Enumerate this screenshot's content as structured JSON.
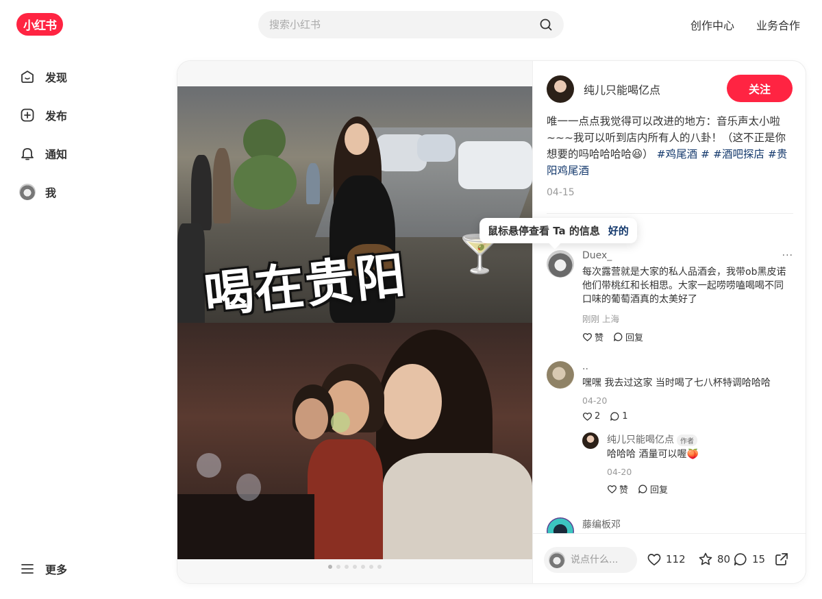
{
  "header": {
    "logo_text": "小红书",
    "search_placeholder": "搜索小红书",
    "nav": [
      "创作中心",
      "业务合作"
    ]
  },
  "sidebar": {
    "items": [
      {
        "label": "发现",
        "icon": "discover-icon"
      },
      {
        "label": "发布",
        "icon": "publish-icon"
      },
      {
        "label": "通知",
        "icon": "bell-icon"
      },
      {
        "label": "我",
        "icon": "avatar"
      }
    ],
    "more_label": "更多"
  },
  "note": {
    "image_caption": "喝在贵阳",
    "carousel_count": 7,
    "carousel_active": 1,
    "author": "纯儿只能喝亿点",
    "follow_label": "关注",
    "desc_text": "唯一一点点我觉得可以改进的地方：音乐声太小啦~~~我可以听到店内所有人的八卦！（这不正是你想要的吗哈哈哈哈😆）",
    "tags": [
      "#鸡尾酒",
      "#",
      "#酒吧探店",
      "#贵阳鸡尾酒"
    ],
    "date": "04-15"
  },
  "tooltip": {
    "text": "鼠标悬停查看 Ta 的信息",
    "ok_label": "好的"
  },
  "comments": [
    {
      "name": "Duex_",
      "text": "每次露营就是大家的私人品酒会，我带ob黑皮诺他们带桃红和长相思。大家一起唠唠嗑喝喝不同口味的葡萄酒真的太美好了",
      "meta": "刚刚 上海",
      "like_label": "赞",
      "reply_label": "回复"
    },
    {
      "name": "..",
      "text": "嘿嘿 我去过这家 当时喝了七八杯特调哈哈哈",
      "meta": "04-20",
      "like_label": "2",
      "reply_label": "1",
      "reply": {
        "name": "纯儿只能喝亿点",
        "badge": "作者",
        "text": "哈哈哈 酒量可以喔🍑",
        "meta": "04-20",
        "like_label": "赞",
        "reply_label": "回复"
      }
    },
    {
      "name": "藤编板邓"
    }
  ],
  "footer": {
    "input_placeholder": "说点什么...",
    "likes": "112",
    "collects": "80",
    "comments": "15"
  },
  "colors": {
    "brand": "#ff2442",
    "tag": "#13386c"
  }
}
